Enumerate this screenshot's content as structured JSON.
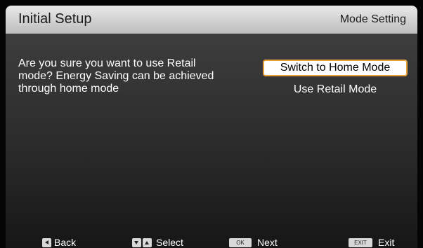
{
  "header": {
    "title": "Initial Setup",
    "section": "Mode Setting"
  },
  "dialog": {
    "message": "Are you sure you want to use Retail mode? Energy Saving can be achieved through home mode",
    "options": [
      {
        "label": "Switch to Home Mode",
        "selected": true
      },
      {
        "label": "Use Retail Mode",
        "selected": false
      }
    ]
  },
  "footer": {
    "back": {
      "icon": "left-arrow-key-icon",
      "label": "Back"
    },
    "select": {
      "icons": [
        "down-arrow-key-icon",
        "up-arrow-key-icon"
      ],
      "label": "Select"
    },
    "next": {
      "key_label": "OK",
      "label": "Next"
    },
    "exit": {
      "key_label": "EXIT",
      "label": "Exit"
    }
  },
  "colors": {
    "highlight_border": "#e8a23c",
    "title_bar": "#d4d4d4"
  }
}
